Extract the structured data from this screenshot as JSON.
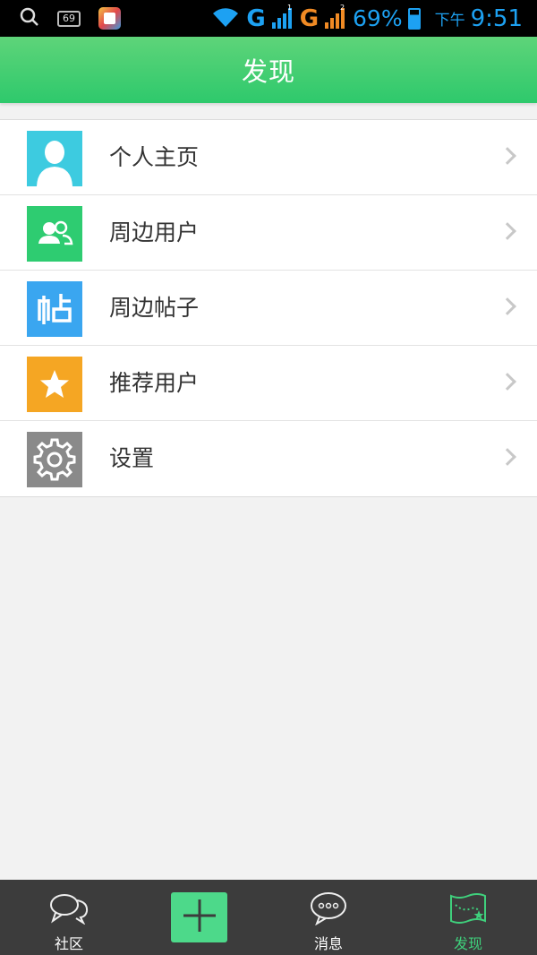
{
  "status_bar": {
    "notification_count": "69",
    "network_1": "G",
    "sim_1": "1",
    "network_2": "G",
    "sim_2": "2",
    "battery_percent": "69%",
    "ampm": "下午",
    "time": "9:51",
    "icons": [
      "search-icon",
      "notification-count-icon",
      "app-notification-icon",
      "wifi-icon",
      "signal-icon",
      "battery-icon"
    ]
  },
  "header": {
    "title": "发现"
  },
  "menu": {
    "items": [
      {
        "label": "个人主页",
        "icon": "profile-icon",
        "color": "#3dcbe0"
      },
      {
        "label": "周边用户",
        "icon": "nearby-users-icon",
        "color": "#2ecc71"
      },
      {
        "label": "周边帖子",
        "icon": "nearby-posts-icon",
        "color": "#3aa6f0"
      },
      {
        "label": "推荐用户",
        "icon": "star-icon",
        "color": "#f5a623"
      },
      {
        "label": "设置",
        "icon": "gear-icon",
        "color": "#8a8a8a"
      }
    ]
  },
  "bottom_nav": {
    "tabs": [
      {
        "label": "社区",
        "icon": "community-chat-icon",
        "active": false
      },
      {
        "label": "",
        "icon": "plus-icon",
        "active": false
      },
      {
        "label": "消息",
        "icon": "message-icon",
        "active": false
      },
      {
        "label": "发现",
        "icon": "discover-map-icon",
        "active": true
      }
    ],
    "active_color": "#3fd07c",
    "add_button_color": "#4dd98a"
  },
  "colors": {
    "header_green": "#2ec96c",
    "background": "#f2f2f2",
    "nav_background": "#3c3c3c"
  }
}
